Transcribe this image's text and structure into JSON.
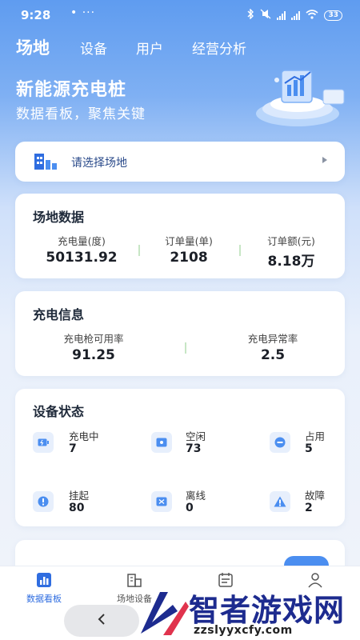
{
  "status_bar": {
    "time": "9:28",
    "dots": "• ···",
    "battery": "33"
  },
  "top_tabs": [
    {
      "label": "场地",
      "active": true
    },
    {
      "label": "设备",
      "active": false
    },
    {
      "label": "用户",
      "active": false
    },
    {
      "label": "经营分析",
      "active": false
    }
  ],
  "hero": {
    "title": "新能源充电桩",
    "subtitle": "数据看板，聚焦关键"
  },
  "site_selector": {
    "label": "请选择场地"
  },
  "site_data": {
    "title": "场地数据",
    "stats": [
      {
        "label": "充电量(度)",
        "value": "50131.92"
      },
      {
        "label": "订单量(单)",
        "value": "2108"
      },
      {
        "label": "订单额(元)",
        "value": "8.18万"
      }
    ]
  },
  "charge_info": {
    "title": "充电信息",
    "stats": [
      {
        "label": "充电枪可用率",
        "value": "91.25"
      },
      {
        "label": "充电异常率",
        "value": "2.5"
      }
    ]
  },
  "device_status": {
    "title": "设备状态",
    "items": [
      {
        "label": "充电中",
        "value": "7",
        "icon": "charging-icon"
      },
      {
        "label": "空闲",
        "value": "73",
        "icon": "idle-icon"
      },
      {
        "label": "占用",
        "value": "5",
        "icon": "occupied-icon"
      },
      {
        "label": "挂起",
        "value": "80",
        "icon": "suspended-icon"
      },
      {
        "label": "离线",
        "value": "0",
        "icon": "offline-icon"
      },
      {
        "label": "故障",
        "value": "2",
        "icon": "fault-icon"
      }
    ]
  },
  "bottom_nav": [
    {
      "label": "数据看板",
      "active": true,
      "icon": "bar-chart-icon"
    },
    {
      "label": "场地设备",
      "active": false,
      "icon": "building-icon"
    },
    {
      "label": "",
      "active": false,
      "icon": "calendar-icon"
    },
    {
      "label": "",
      "active": false,
      "icon": "user-icon"
    }
  ],
  "colors": {
    "accent": "#2f6de0",
    "brand_blue": "#4b8ef0"
  },
  "watermark": {
    "text": "智者游戏网",
    "url": "zzslyyxcfy.com"
  }
}
